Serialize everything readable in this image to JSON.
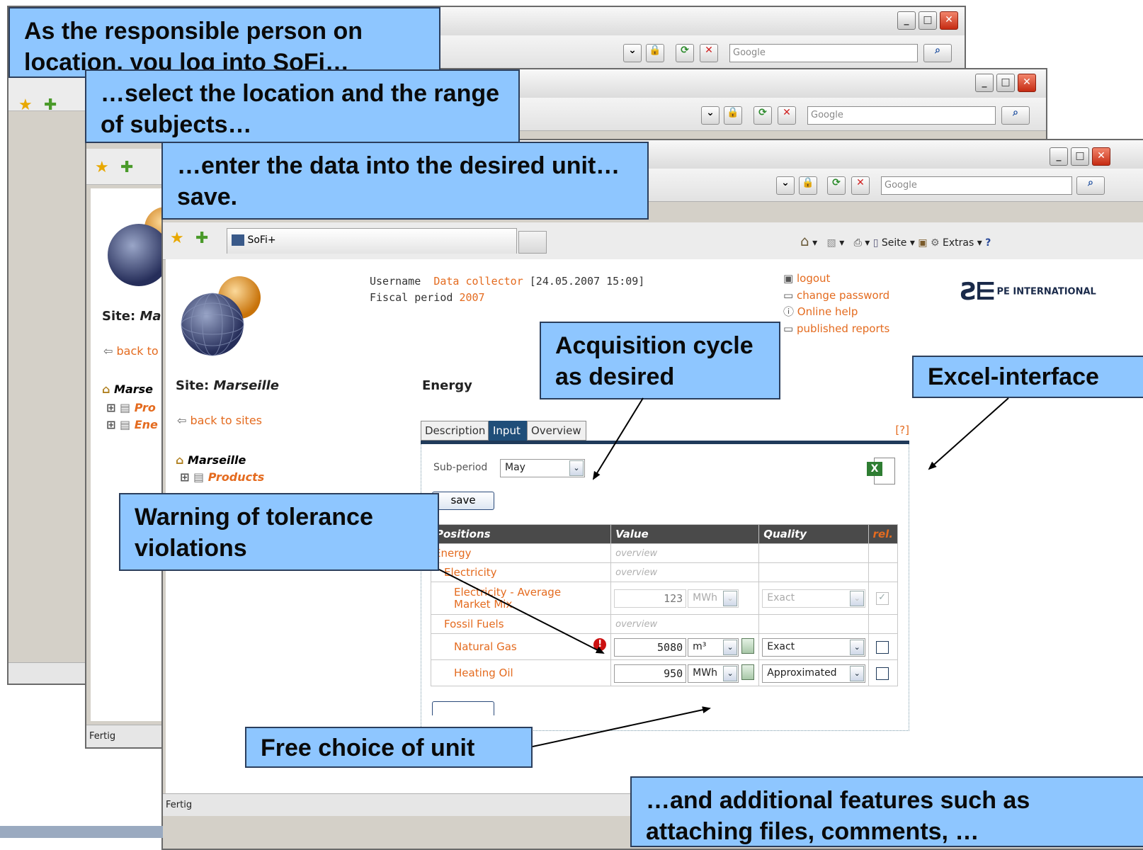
{
  "callouts": {
    "login": "As the responsible person on location, you log into SoFi…",
    "select": "…select the location and the range of subjects…",
    "enter": "…enter the data into the desired unit…save.",
    "acquisition": "Acquisition cycle as desired",
    "excel": "Excel-interface",
    "warning": "Warning of tolerance violations",
    "unit_choice": "Free choice of unit",
    "additional": "…and additional features such as attaching files, comments, …"
  },
  "browser": {
    "search_placeholder": "Google",
    "tab_title": "SoFi+",
    "status": "Fertig",
    "toolbar": {
      "page": "Seite",
      "extras": "Extras"
    }
  },
  "header": {
    "username_label": "Username",
    "username_value": "Data collector",
    "timestamp": "[24.05.2007 15:09]",
    "fiscal_label": "Fiscal period",
    "fiscal_value": "2007",
    "brand": "PE INTERNATIONAL"
  },
  "links": {
    "logout": "logout",
    "change_password": "change password",
    "online_help": "Online help",
    "published_reports": "published reports"
  },
  "sidebar": {
    "site_label": "Site:",
    "site_name": "Marseille",
    "back": "back to sites",
    "tree_root": "Marseille",
    "tree_items": [
      "Products",
      "Energy"
    ],
    "back_truncated": "back to",
    "site_name_trunc": "Ma",
    "root_trunc": "Marse",
    "item_trunc": [
      "Pro",
      "Ene"
    ]
  },
  "main": {
    "section_title": "Energy",
    "tabs": [
      "Description",
      "Input",
      "Overview"
    ],
    "help": "[?]",
    "subperiod_label": "Sub-period",
    "subperiod_value": "May",
    "save_button": "save",
    "columns": [
      "Positions",
      "Value",
      "Quality",
      "rel."
    ],
    "rows": [
      {
        "position": "Energy",
        "value": "overview"
      },
      {
        "position": "Electricity",
        "value": "overview"
      },
      {
        "position": "Electricity - Average Market Mix",
        "amount": "123",
        "unit": "MWh",
        "quality": "Exact",
        "rel": "✓"
      },
      {
        "position": "Fossil Fuels",
        "value": "overview"
      },
      {
        "position": "Natural Gas",
        "amount": "5080",
        "unit": "m³",
        "quality": "Exact",
        "warning": "!"
      },
      {
        "position": "Heating Oil",
        "amount": "950",
        "unit": "MWh",
        "quality": "Approximated"
      }
    ]
  },
  "colors": {
    "callout_bg": "#8ec6ff",
    "link_orange": "#e46b1f",
    "active_tab": "#1f4e79",
    "warning_red": "#cc1111"
  }
}
